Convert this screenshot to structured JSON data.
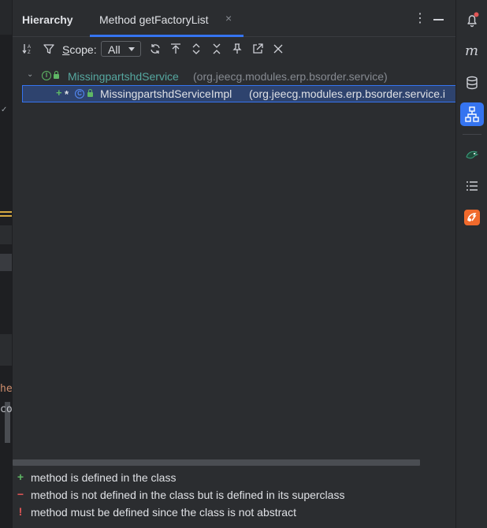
{
  "panel": {
    "title": "Hierarchy",
    "tab_label": "Method getFactoryList",
    "tab_close": "×",
    "kebab": "⋮"
  },
  "toolbar": {
    "scope_prefix": "S",
    "scope_rest": "cope:",
    "scope_value": "All"
  },
  "tree": {
    "root": {
      "name": "MissingpartshdService",
      "package": "(org.jeecg.modules.erp.bsorder.service)"
    },
    "child": {
      "plus": "+",
      "star": "*",
      "name": "MissingpartshdServiceImpl",
      "package": "(org.jeecg.modules.erp.bsorder.service.i"
    }
  },
  "legend": [
    {
      "symbol": "+",
      "color": "#5fb865",
      "text": "method is defined in the class"
    },
    {
      "symbol": "−",
      "color": "#e05555",
      "text": "method is not defined in the class but is defined in its superclass"
    },
    {
      "symbol": "!",
      "color": "#e05555",
      "text": "method must be defined since the class is not abstract"
    }
  ],
  "editor_fragments": {
    "text1": "he",
    "text2": "co"
  },
  "colors": {
    "accent": "#3574f0",
    "interface_name": "#56a8a0",
    "notification_badge": "#e05555",
    "plugin_orange": "#f06a2c"
  }
}
